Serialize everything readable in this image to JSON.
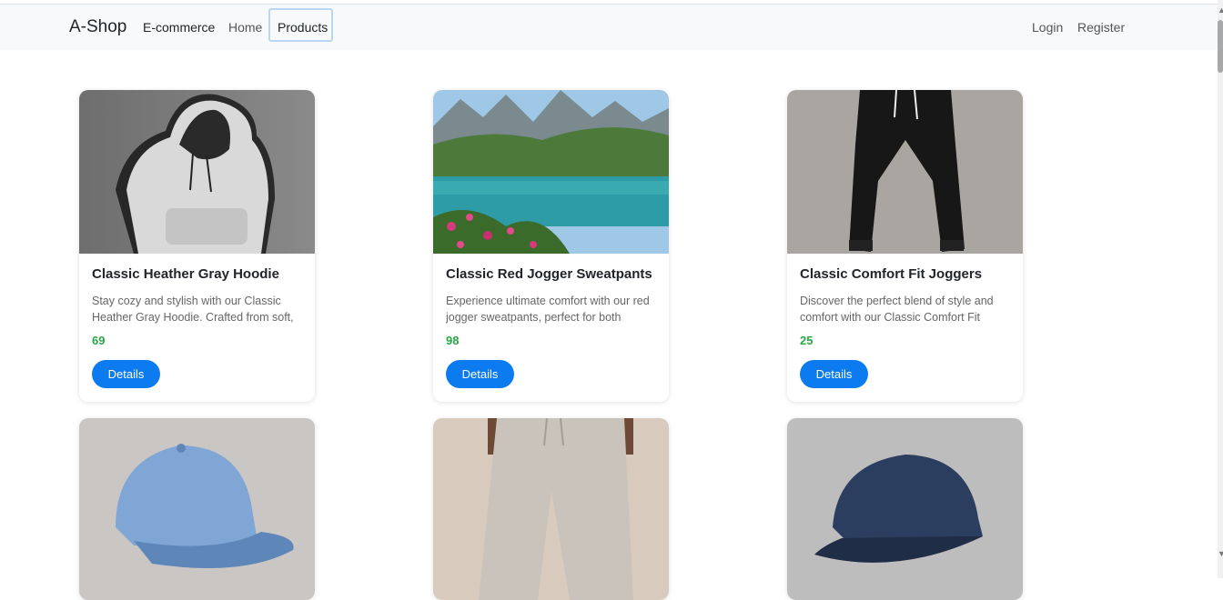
{
  "navbar": {
    "brand": "A-Shop",
    "links": {
      "ecommerce": "E-commerce",
      "home": "Home",
      "products": "Products",
      "login": "Login",
      "register": "Register"
    }
  },
  "products": [
    {
      "title": "Classic Heather Gray Hoodie",
      "description": "Stay cozy and stylish with our Classic Heather Gray Hoodie. Crafted from soft,",
      "price": "69",
      "button": "Details",
      "image": "gray-hoodie"
    },
    {
      "title": "Classic Red Jogger Sweatpants",
      "description": "Experience ultimate comfort with our red jogger sweatpants, perfect for both",
      "price": "98",
      "button": "Details",
      "image": "mountain-lake"
    },
    {
      "title": "Classic Comfort Fit Joggers",
      "description": "Discover the perfect blend of style and comfort with our Classic Comfort Fit",
      "price": "25",
      "button": "Details",
      "image": "black-joggers"
    },
    {
      "image": "light-blue-cap"
    },
    {
      "image": "beige-pants"
    },
    {
      "image": "navy-cap"
    }
  ],
  "colors": {
    "primary": "#0d7bf0",
    "price": "#28a745",
    "navbar_bg": "#f8f9fa"
  }
}
